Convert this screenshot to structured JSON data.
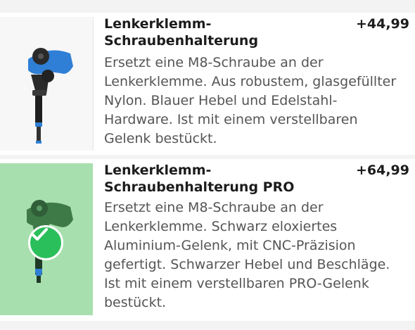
{
  "options": [
    {
      "title": "Lenkerklemm-\nSchraubenhalterung",
      "price": "+44,99",
      "description": "Ersetzt eine M8-Schraube an der\nLenkerklemme. Aus robustem, glasgefüllter\nNylon. Blauer Hebel und Edelstahl-\nHardware. Ist mit einem verstellbaren\nGelenk bestückt.",
      "selected": false,
      "image_icon": "blue-lever-mount-icon",
      "accent_color": "#2f7fd6"
    },
    {
      "title": "Lenkerklemm-\nSchraubenhalterung PRO",
      "price": "+64,99",
      "description": "Ersetzt eine M8-Schraube an der\nLenkerklemme. Schwarz eloxiertes\nAluminium-Gelenk, mit CNC-Präzision\ngefertigt. Schwarzer Hebel und Beschläge.\nIst mit einem verstellbaren PRO-Gelenk\nbestückt.",
      "selected": true,
      "image_icon": "black-lever-mount-icon",
      "selected_indicator": "checkmark-icon",
      "selected_bg": "#a8dfae",
      "check_color": "#2bbf5b"
    }
  ]
}
